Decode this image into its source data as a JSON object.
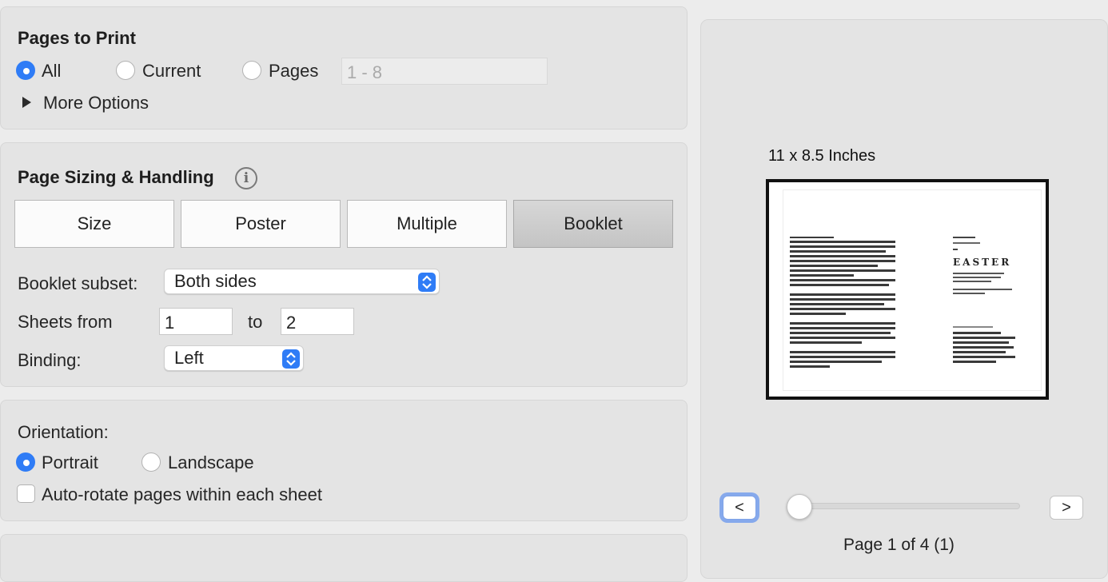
{
  "pages_to_print": {
    "title": "Pages to Print",
    "options": [
      "All",
      "Current",
      "Pages"
    ],
    "selected": "All",
    "range_value": "1 - 8",
    "more_options": "More Options"
  },
  "page_sizing": {
    "title": "Page Sizing & Handling",
    "segments": [
      "Size",
      "Poster",
      "Multiple",
      "Booklet"
    ],
    "selected_segment": "Booklet",
    "booklet_subset_label": "Booklet subset:",
    "booklet_subset_value": "Both sides",
    "sheets_from_label": "Sheets from",
    "sheets_from_value": "1",
    "to_label": "to",
    "sheets_to_value": "2",
    "binding_label": "Binding:",
    "binding_value": "Left"
  },
  "orientation": {
    "title": "Orientation:",
    "options": [
      "Portrait",
      "Landscape"
    ],
    "selected": "Portrait",
    "auto_rotate_label": "Auto-rotate pages within each sheet",
    "auto_rotate_checked": false
  },
  "preview": {
    "paper_size": "11 x 8.5 Inches",
    "cover_word": "EASTER",
    "prev_label": "<",
    "next_label": ">",
    "page_indicator": "Page 1 of 4 (1)",
    "slider_position_fraction": 0
  },
  "colors": {
    "accent": "#2f7cf6",
    "panel_bg": "#e4e4e4",
    "window_bg": "#ececec"
  }
}
